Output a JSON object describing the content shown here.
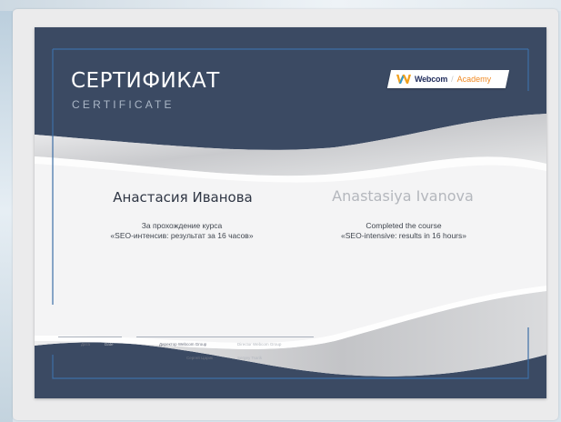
{
  "certificate": {
    "title_ru": "СЕРТИФИКАТ",
    "title_en": "CERTIFICATE",
    "logo": {
      "brand": "Webcom",
      "suffix": "Academy",
      "mark_icon": "webcom-w-logo-icon"
    },
    "recipient_ru": "Анастасия Иванова",
    "recipient_en": "Anastasiya Ivanova",
    "course_ru": {
      "line1": "За прохождение курса",
      "line2": "«SEO-интенсив: результат за 16 часов»"
    },
    "course_en": {
      "line1": "Completed the course",
      "line2": "«SEO-intensive: results in 16 hours»"
    },
    "footer": {
      "date_label_ru": "Дата",
      "date_label_en": "Date",
      "director_label_ru": "Директор Webcom Group",
      "director_label_en": "Director Webcom Group",
      "director_name_ru": "Сергей Царик",
      "director_name_en": "Sergey Tsarik"
    }
  },
  "colors": {
    "header_navy": "#3b4a63",
    "frame_blue": "#3e6fa6",
    "logo_orange": "#f08a24",
    "logo_navy": "#232f5e"
  }
}
